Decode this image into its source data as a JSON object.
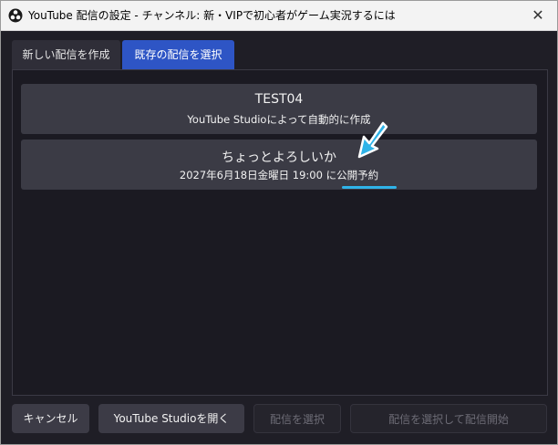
{
  "window": {
    "title": "YouTube 配信の設定 - チャンネル: 新・VIPで初心者がゲーム実況するには",
    "close_glyph": "✕"
  },
  "tabs": [
    {
      "label": "新しい配信を作成",
      "active": false
    },
    {
      "label": "既存の配信を選択",
      "active": true
    }
  ],
  "broadcasts": [
    {
      "title": "TEST04",
      "subtitle": "YouTube Studioによって自動的に作成"
    },
    {
      "title": "ちょっとよろしいか",
      "subtitle": "2027年6月18日金曜日 19:00 に公開予約"
    }
  ],
  "footer": {
    "cancel_label": "キャンセル",
    "open_studio_label": "YouTube Studioを開く",
    "select_label": "配信を選択",
    "select_start_label": "配信を選択して配信開始"
  },
  "colors": {
    "accent_tab": "#2e55c5",
    "annotation": "#2fb3e8",
    "background": "#1f1e26"
  },
  "icons": {
    "app": "obs-logo-icon",
    "annotation": "arrow-down-left-icon"
  }
}
